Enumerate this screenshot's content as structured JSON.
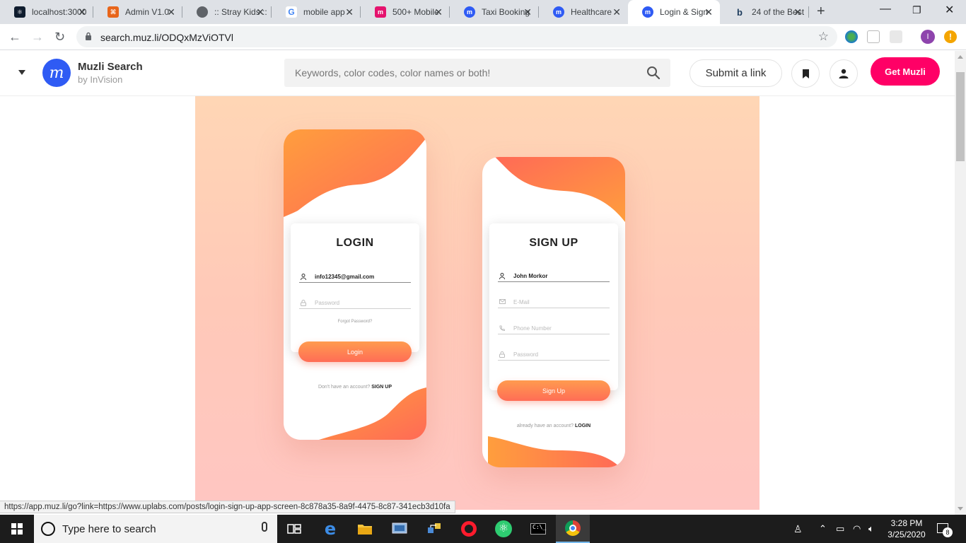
{
  "browser": {
    "tabs": [
      {
        "title": "localhost:3000",
        "favicon_color": "#0f1c2e"
      },
      {
        "title": "Admin V1.0",
        "favicon_color": "#e8651a"
      },
      {
        "title": ":: Stray Kids ::",
        "favicon_color": "#5f6368"
      },
      {
        "title": "mobile app",
        "favicon_color": "#ffffff"
      },
      {
        "title": "500+ Mobile",
        "favicon_color": "#e5136e"
      },
      {
        "title": "Taxi Booking",
        "favicon_color": "#2f5bf4"
      },
      {
        "title": "Healthcare",
        "favicon_color": "#2f5bf4"
      },
      {
        "title": "Login & Sign",
        "favicon_color": "#2f5bf4",
        "active": true
      },
      {
        "title": "24 of the Best",
        "favicon_color": "#1b3a5c"
      }
    ],
    "url": "search.muz.li/ODQxMzViOTVl",
    "profile_initial": "I"
  },
  "muzli": {
    "logo_letter": "m",
    "brand": "Muzli Search",
    "brand_sub": "by InVision",
    "search_placeholder": "Keywords, color codes, color names or both!",
    "submit_label": "Submit a link",
    "get_label": "Get Muzli",
    "brand_color": "#ff0066",
    "logo_color": "#2f5bf4"
  },
  "shot": {
    "login": {
      "title": "LOGIN",
      "email": "info12345@gmail.com",
      "password_placeholder": "Password",
      "forgot": "Forgot Password?",
      "button": "Login",
      "footer_text": "Don't have an account?",
      "footer_link": "SIGN UP"
    },
    "signup": {
      "title": "SIGN UP",
      "name": "John Morkor",
      "email_placeholder": "E-Mail",
      "phone_placeholder": "Phone Number",
      "password_placeholder": "Password",
      "button": "Sign Up",
      "footer_text": "already have an account?",
      "footer_link": "LOGIN"
    },
    "accent_colors": [
      "#ff9a3c",
      "#ff6d56"
    ]
  },
  "status_url": "https://app.muz.li/go?link=https://www.uplabs.com/posts/login-sign-up-app-screen-8c878a35-8a9f-4475-8c87-341ecb3d10fa",
  "taskbar": {
    "search_placeholder": "Type here to search",
    "time": "3:28 PM",
    "date": "3/25/2020",
    "notification_count": "8"
  }
}
